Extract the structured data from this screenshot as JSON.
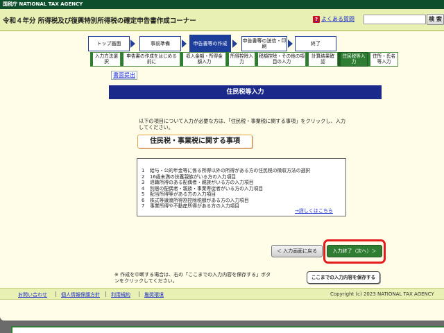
{
  "header": {
    "agency": "国税庁 NATIONAL TAX AGENCY",
    "title": "令和４年分 所得税及び復興特別所得税の確定申告書作成コーナー",
    "faq_icon": "?",
    "faq_label": "よくある質問",
    "search_placeholder": "",
    "search_button": "検 索"
  },
  "steps": [
    {
      "label": "トップ画面"
    },
    {
      "label": "事前準備"
    },
    {
      "label": "申告書等の作成"
    },
    {
      "label": "申告書等の送信・印刷"
    },
    {
      "label": "終了"
    }
  ],
  "active_step": "申告書等の作成",
  "substeps": [
    {
      "label": "入力方法選択"
    },
    {
      "label": "申告書の作成をはじめる前に"
    },
    {
      "label": "収入金額・所得金額入力"
    },
    {
      "label": "所得控除入力"
    },
    {
      "label": "税額控除・その他の項目の入力"
    },
    {
      "label": "計算結果確認"
    },
    {
      "label": "住民税等入力"
    },
    {
      "label": "住所・氏名等入力"
    }
  ],
  "active_substep": "住民税等入力",
  "main": {
    "print_link": "書面提出",
    "section_title": "住民税等入力",
    "instruction": "以下の項目について入力が必要な方は、「住民税・事業税に関する事項」をクリックし、入力してください。",
    "topic_button": "住民税・事業税に関する事項",
    "items": [
      {
        "num": "1",
        "text": "給与・公的年金等に係る所得以外の所得がある方の住民税の徴収方法の選択"
      },
      {
        "num": "2",
        "text": "16歳未満の扶養親族がいる方の入力項目"
      },
      {
        "num": "3",
        "text": "退職所得のある配偶者・親族がいる方の入力項目"
      },
      {
        "num": "4",
        "text": "別居の配偶者・親族・事業専従者がいる方の入力項目"
      },
      {
        "num": "5",
        "text": "配当所得等がある方の入力項目"
      },
      {
        "num": "6",
        "text": "株式等譲渡所得割控除税額がある方の入力項目"
      },
      {
        "num": "7",
        "text": "事業所得や不動産所得がある方の入力項目"
      }
    ],
    "details_link": "→詳しくはこちら"
  },
  "actions": {
    "back_button": "＜ 入力画面に戻る",
    "finish_button": "入力終了（次へ）＞",
    "note": "※ 作成を中断する場合は、右の「ここまでの入力内容を保存する」ボタンをクリックしてください。",
    "save_button": "ここまでの入力内容を保存する"
  },
  "footer": {
    "links": [
      "お問い合わせ",
      "個人情報保護方針",
      "利用規約",
      "推奨環境"
    ],
    "copyright": "Copyright (c) 2023 NATIONAL TAX AGENCY"
  },
  "colors": {
    "brand_green": "#0d4e2c",
    "header_bg": "#e8f0b4",
    "step_blue": "#1e3e9c",
    "substep_green": "#2e7d32",
    "section_navy": "#1b2a8a",
    "highlight_red": "#e41b1b"
  }
}
